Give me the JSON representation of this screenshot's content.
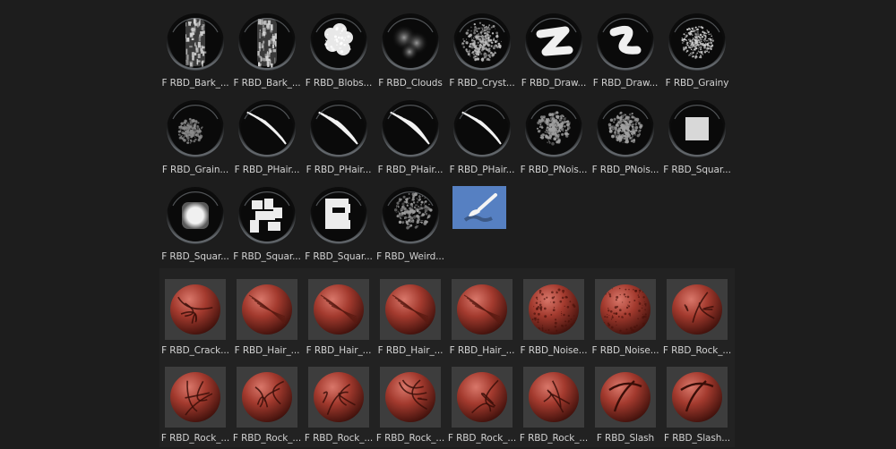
{
  "alpha_brushes": [
    {
      "label": "F RBD_Bark_...",
      "icon": "bark-texture-icon"
    },
    {
      "label": "F RBD_Bark_...",
      "icon": "bark-texture-icon"
    },
    {
      "label": "F RBD_Blobs...",
      "icon": "blobs-texture-icon"
    },
    {
      "label": "F RBD_Clouds",
      "icon": "clouds-texture-icon"
    },
    {
      "label": "F RBD_Cryst...",
      "icon": "crystal-texture-icon"
    },
    {
      "label": "F RBD_Draw...",
      "icon": "draw-stroke-icon"
    },
    {
      "label": "F RBD_Draw...",
      "icon": "draw-stroke-icon"
    },
    {
      "label": "F RBD_Grainy",
      "icon": "grainy-texture-icon"
    },
    {
      "label": "F RBD_Grain...",
      "icon": "grain-texture-icon"
    },
    {
      "label": "F RBD_PHair...",
      "icon": "hair-strands-icon"
    },
    {
      "label": "F RBD_PHair...",
      "icon": "hair-strands-icon"
    },
    {
      "label": "F RBD_PHair...",
      "icon": "hair-strands-icon"
    },
    {
      "label": "F RBD_PHair...",
      "icon": "hair-strands-icon"
    },
    {
      "label": "F RBD_PNois...",
      "icon": "noise-texture-icon"
    },
    {
      "label": "F RBD_PNois...",
      "icon": "noise-texture-icon"
    },
    {
      "label": "F RBD_Squar...",
      "icon": "square-shape-icon"
    },
    {
      "label": "F RBD_Squar...",
      "icon": "rounded-square-icon"
    },
    {
      "label": "F RBD_Squar...",
      "icon": "square-pattern-icon"
    },
    {
      "label": "F RBD_Squar...",
      "icon": "square-pattern-icon"
    },
    {
      "label": "F RBD_Weird...",
      "icon": "weird-texture-icon"
    }
  ],
  "new_brush": {
    "icon": "paint-brush-icon"
  },
  "matcap_brushes": [
    {
      "label": "F RBD_Crack...",
      "icon": "crack-sphere-icon"
    },
    {
      "label": "F RBD_Hair_...",
      "icon": "hair-sphere-icon"
    },
    {
      "label": "F RBD_Hair_...",
      "icon": "hair-sphere-icon"
    },
    {
      "label": "F RBD_Hair_...",
      "icon": "hair-sphere-icon"
    },
    {
      "label": "F RBD_Hair_...",
      "icon": "hair-sphere-icon"
    },
    {
      "label": "F RBD_Noise...",
      "icon": "noise-sphere-icon"
    },
    {
      "label": "F RBD_Noise...",
      "icon": "noise-sphere-icon"
    },
    {
      "label": "F RBD_Rock_...",
      "icon": "rock-sphere-icon"
    },
    {
      "label": "F RBD_Rock_...",
      "icon": "rock-sphere-icon"
    },
    {
      "label": "F RBD_Rock_...",
      "icon": "rock-sphere-icon"
    },
    {
      "label": "F RBD_Rock_...",
      "icon": "rock-sphere-icon"
    },
    {
      "label": "F RBD_Rock_...",
      "icon": "rock-sphere-icon"
    },
    {
      "label": "F RBD_Rock_...",
      "icon": "rock-sphere-icon"
    },
    {
      "label": "F RBD_Rock_...",
      "icon": "rock-sphere-icon"
    },
    {
      "label": "F RBD_Slash",
      "icon": "slash-sphere-icon"
    },
    {
      "label": "F RBD_Slash...",
      "icon": "slash-sphere-icon"
    }
  ],
  "colors": {
    "background": "#1d1d1d",
    "lower_panel": "#222222",
    "label_text": "#d2d2d2",
    "selected_accent": "#5680c2",
    "clay_red": "#a33a2e"
  }
}
